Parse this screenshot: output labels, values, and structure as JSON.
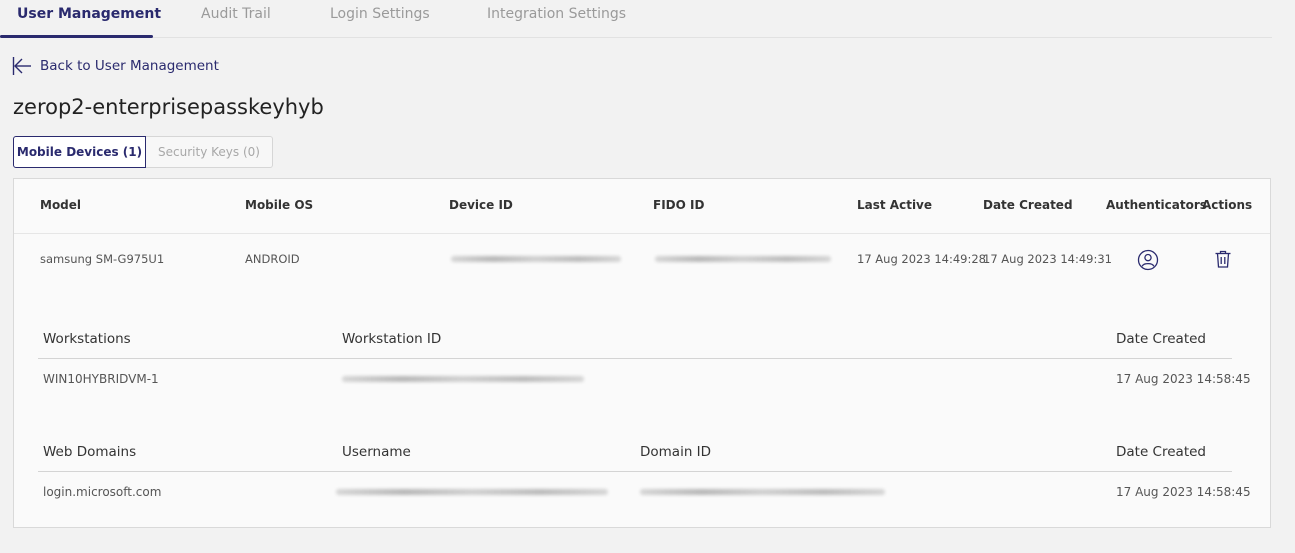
{
  "tabs": [
    {
      "label": "User Management",
      "active": true
    },
    {
      "label": "Audit Trail",
      "active": false
    },
    {
      "label": "Login Settings",
      "active": false
    },
    {
      "label": "Integration Settings",
      "active": false
    }
  ],
  "back_link": {
    "label": "Back to User Management",
    "icon": "arrow-left-icon"
  },
  "page_title": "zerop2-enterprisepasskeyhyb",
  "device_tabs": {
    "mobile": "Mobile Devices (1)",
    "keys": "Security Keys (0)"
  },
  "devices_table": {
    "headers": {
      "model": "Model",
      "mobile_os": "Mobile OS",
      "device_id": "Device ID",
      "fido_id": "FIDO ID",
      "last_active": "Last Active",
      "date_created": "Date Created",
      "authenticators": "Authenticators",
      "actions": "Actions"
    },
    "row": {
      "model": "samsung SM-G975U1",
      "mobile_os": "ANDROID",
      "last_active": "17 Aug 2023 14:49:28",
      "date_created": "17 Aug 2023 14:49:31",
      "authenticator_icon": "user-circle-icon",
      "delete_icon": "trash-icon"
    }
  },
  "workstations": {
    "headers": {
      "name": "Workstations",
      "id": "Workstation ID",
      "date": "Date Created"
    },
    "row": {
      "name": "WIN10HYBRIDVM-1",
      "date": "17 Aug 2023 14:58:45"
    }
  },
  "web_domains": {
    "headers": {
      "name": "Web Domains",
      "username": "Username",
      "domain_id": "Domain ID",
      "date": "Date Created"
    },
    "row": {
      "name": "login.microsoft.com",
      "date": "17 Aug 2023 14:58:45"
    }
  },
  "colors": {
    "accent": "#2a2a6e",
    "background": "#f2f2f2",
    "panel": "#fafafa"
  }
}
